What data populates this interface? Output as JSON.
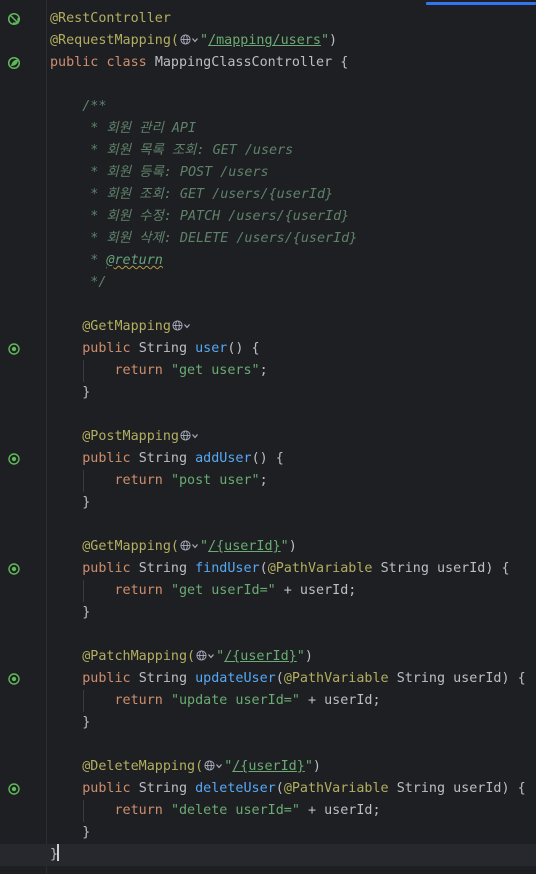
{
  "editor": {
    "file": "MappingClassController.java",
    "lines": [
      {
        "gutter": "bean-icon",
        "tokens": [
          {
            "t": "@RestController",
            "c": "ann"
          }
        ]
      },
      {
        "gutter": "",
        "tokens": [
          {
            "t": "@RequestMapping(",
            "c": "ann"
          },
          {
            "globe": true
          },
          {
            "t": "\"",
            "c": "str"
          },
          {
            "t": "/mapping/users",
            "c": "str",
            "u": true
          },
          {
            "t": "\"",
            "c": "str"
          },
          {
            "t": ")"
          }
        ]
      },
      {
        "gutter": "bean-leaf-icon",
        "tokens": [
          {
            "t": "public ",
            "c": "kw"
          },
          {
            "t": "class ",
            "c": "kw"
          },
          {
            "t": "MappingClassController "
          },
          {
            "t": "{"
          }
        ]
      },
      {
        "gutter": "",
        "tokens": []
      },
      {
        "gutter": "",
        "tokens": [
          {
            "t": "    /**",
            "c": "doc"
          }
        ]
      },
      {
        "gutter": "",
        "tokens": [
          {
            "t": "     * 회원 관리 API",
            "c": "doc"
          }
        ]
      },
      {
        "gutter": "",
        "tokens": [
          {
            "t": "     * 회원 목록 조회: GET /users",
            "c": "doc"
          }
        ]
      },
      {
        "gutter": "",
        "tokens": [
          {
            "t": "     * 회원 등록: POST /users",
            "c": "doc"
          }
        ]
      },
      {
        "gutter": "",
        "tokens": [
          {
            "t": "     * 회원 조회: GET /users/{userId}",
            "c": "doc"
          }
        ]
      },
      {
        "gutter": "",
        "tokens": [
          {
            "t": "     * 회원 수정: PATCH /users/{userId}",
            "c": "doc"
          }
        ]
      },
      {
        "gutter": "",
        "tokens": [
          {
            "t": "     * 회원 삭제: DELETE /users/{userId}",
            "c": "doc"
          }
        ]
      },
      {
        "gutter": "",
        "tokens": [
          {
            "t": "     * ",
            "c": "doc"
          },
          {
            "t": "@return",
            "c": "doctag"
          }
        ]
      },
      {
        "gutter": "",
        "tokens": [
          {
            "t": "     */",
            "c": "doc"
          }
        ]
      },
      {
        "gutter": "",
        "tokens": []
      },
      {
        "gutter": "",
        "tokens": [
          {
            "t": "    @GetMapping",
            "c": "ann"
          },
          {
            "globe": true
          }
        ]
      },
      {
        "gutter": "endpoint-icon",
        "tokens": [
          {
            "t": "    "
          },
          {
            "t": "public ",
            "c": "kw"
          },
          {
            "t": "String "
          },
          {
            "t": "user",
            "c": "fn"
          },
          {
            "t": "() {"
          }
        ]
      },
      {
        "gutter": "",
        "tokens": [
          {
            "t": "        "
          },
          {
            "t": "return ",
            "c": "kw"
          },
          {
            "t": "\"get users\"",
            "c": "str"
          },
          {
            "t": ";"
          }
        ]
      },
      {
        "gutter": "",
        "tokens": [
          {
            "t": "    }"
          }
        ]
      },
      {
        "gutter": "",
        "tokens": []
      },
      {
        "gutter": "",
        "tokens": [
          {
            "t": "    @PostMapping",
            "c": "ann"
          },
          {
            "globe": true
          }
        ]
      },
      {
        "gutter": "endpoint-icon",
        "tokens": [
          {
            "t": "    "
          },
          {
            "t": "public ",
            "c": "kw"
          },
          {
            "t": "String "
          },
          {
            "t": "addUser",
            "c": "fn"
          },
          {
            "t": "() {"
          }
        ]
      },
      {
        "gutter": "",
        "tokens": [
          {
            "t": "        "
          },
          {
            "t": "return ",
            "c": "kw"
          },
          {
            "t": "\"post user\"",
            "c": "str"
          },
          {
            "t": ";"
          }
        ]
      },
      {
        "gutter": "",
        "tokens": [
          {
            "t": "    }"
          }
        ]
      },
      {
        "gutter": "",
        "tokens": []
      },
      {
        "gutter": "",
        "tokens": [
          {
            "t": "    @GetMapping(",
            "c": "ann"
          },
          {
            "globe": true
          },
          {
            "t": "\"",
            "c": "str"
          },
          {
            "t": "/{userId}",
            "c": "str",
            "u": true
          },
          {
            "t": "\"",
            "c": "str"
          },
          {
            "t": ")"
          }
        ]
      },
      {
        "gutter": "endpoint-icon",
        "tokens": [
          {
            "t": "    "
          },
          {
            "t": "public ",
            "c": "kw"
          },
          {
            "t": "String "
          },
          {
            "t": "findUser",
            "c": "fn"
          },
          {
            "t": "("
          },
          {
            "t": "@PathVariable ",
            "c": "ann"
          },
          {
            "t": "String userId) {"
          }
        ]
      },
      {
        "gutter": "",
        "tokens": [
          {
            "t": "        "
          },
          {
            "t": "return ",
            "c": "kw"
          },
          {
            "t": "\"get userId=\"",
            "c": "str"
          },
          {
            "t": " + userId;"
          }
        ]
      },
      {
        "gutter": "",
        "tokens": [
          {
            "t": "    }"
          }
        ]
      },
      {
        "gutter": "",
        "tokens": []
      },
      {
        "gutter": "",
        "tokens": [
          {
            "t": "    @PatchMapping(",
            "c": "ann"
          },
          {
            "globe": true
          },
          {
            "t": "\"",
            "c": "str"
          },
          {
            "t": "/{userId}",
            "c": "str",
            "u": true
          },
          {
            "t": "\"",
            "c": "str"
          },
          {
            "t": ")"
          }
        ]
      },
      {
        "gutter": "endpoint-icon",
        "tokens": [
          {
            "t": "    "
          },
          {
            "t": "public ",
            "c": "kw"
          },
          {
            "t": "String "
          },
          {
            "t": "updateUser",
            "c": "fn"
          },
          {
            "t": "("
          },
          {
            "t": "@PathVariable ",
            "c": "ann"
          },
          {
            "t": "String userId) {"
          }
        ]
      },
      {
        "gutter": "",
        "tokens": [
          {
            "t": "        "
          },
          {
            "t": "return ",
            "c": "kw"
          },
          {
            "t": "\"update userId=\"",
            "c": "str"
          },
          {
            "t": " + userId;"
          }
        ]
      },
      {
        "gutter": "",
        "tokens": [
          {
            "t": "    }"
          }
        ]
      },
      {
        "gutter": "",
        "tokens": []
      },
      {
        "gutter": "",
        "tokens": [
          {
            "t": "    @DeleteMapping(",
            "c": "ann"
          },
          {
            "globe": true
          },
          {
            "t": "\"",
            "c": "str"
          },
          {
            "t": "/{userId}",
            "c": "str",
            "u": true
          },
          {
            "t": "\"",
            "c": "str"
          },
          {
            "t": ")"
          }
        ]
      },
      {
        "gutter": "endpoint-icon",
        "tokens": [
          {
            "t": "    "
          },
          {
            "t": "public ",
            "c": "kw"
          },
          {
            "t": "String "
          },
          {
            "t": "deleteUser",
            "c": "fn"
          },
          {
            "t": "("
          },
          {
            "t": "@PathVariable ",
            "c": "ann"
          },
          {
            "t": "String userId) {"
          }
        ]
      },
      {
        "gutter": "",
        "tokens": [
          {
            "t": "        "
          },
          {
            "t": "return ",
            "c": "kw"
          },
          {
            "t": "\"delete userId=\"",
            "c": "str"
          },
          {
            "t": " + userId;"
          }
        ]
      },
      {
        "gutter": "",
        "tokens": [
          {
            "t": "    }"
          }
        ]
      },
      {
        "gutter": "",
        "current": true,
        "tokens": [
          {
            "t": "}"
          },
          {
            "caret": true
          }
        ]
      }
    ]
  },
  "colors": {
    "background": "#1e1f22",
    "keyword": "#cf8e6d",
    "annotation": "#b3ae60",
    "string": "#6aab73",
    "method": "#56a8f5",
    "comment": "#5f826b",
    "text": "#bcbec4",
    "gutter_icon": "#5fb85a"
  }
}
